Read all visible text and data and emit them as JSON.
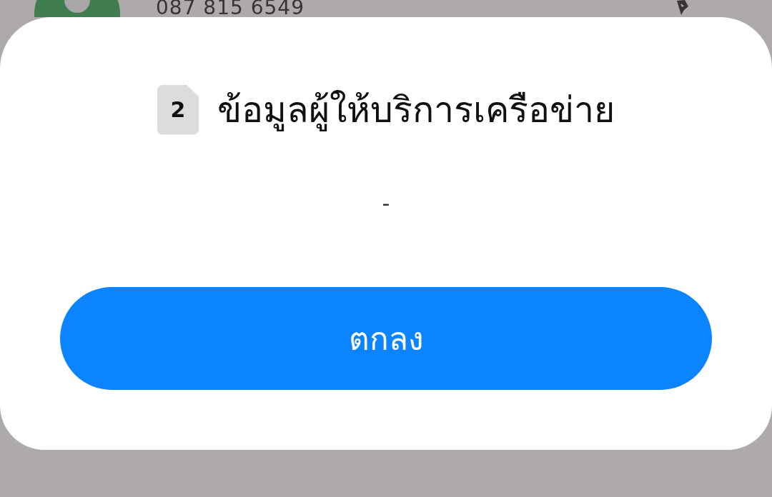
{
  "background_contact": {
    "phone": "087 815 6549"
  },
  "dialog": {
    "sim_slot": "2",
    "title": "ข้อมูลผู้ให้บริการเครือข่าย",
    "value": "-",
    "buttons": [
      {
        "label": "ตกลง",
        "kind": "primary"
      }
    ]
  }
}
